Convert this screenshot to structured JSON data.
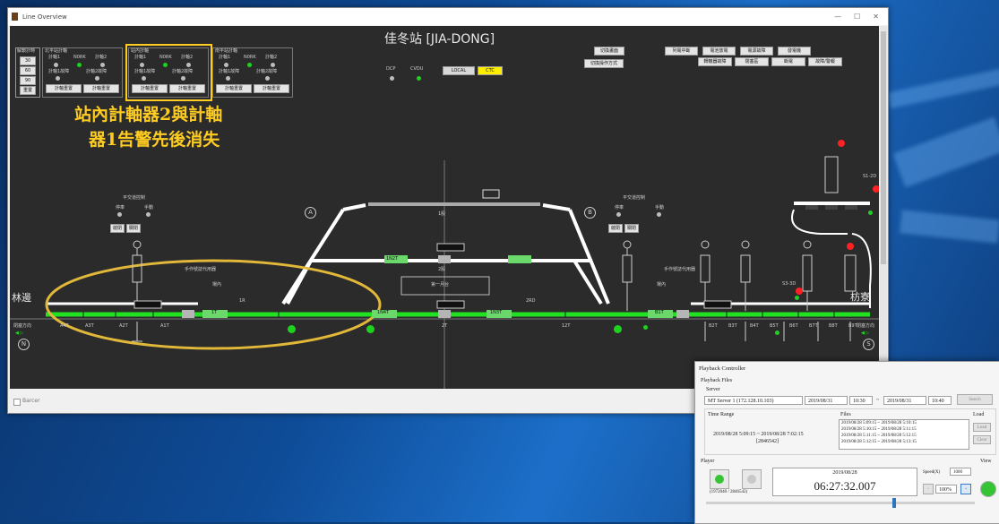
{
  "window": {
    "title": "Line Overview",
    "minimize": "—",
    "maximize": "☐",
    "close": "✕",
    "status_checkbox_label": "Barcer"
  },
  "station_title": "佳冬站 [JIA-DONG]",
  "annotation": {
    "line1": "站內計軸器2與計軸",
    "line2": "器1告警先後消失",
    "highlight_color": "#ffcc22"
  },
  "left_box": {
    "label": "解鎖計時",
    "values": [
      "30",
      "60",
      "90",
      "重置"
    ]
  },
  "axle_groups": [
    {
      "title": "北平站計軸",
      "items": [
        "計軸1",
        "N0RK",
        "計軸2"
      ],
      "sub": [
        "計軸1故障",
        "計軸2故障"
      ],
      "buttons": [
        "計軸重置",
        "計軸重置"
      ]
    },
    {
      "title": "站內計軸",
      "items": [
        "計軸1",
        "N0RK",
        "計軸2"
      ],
      "sub": [
        "計軸1故障",
        "計軸2故障"
      ],
      "buttons": [
        "計軸重置",
        "計軸重置"
      ]
    },
    {
      "title": "南平站計軸",
      "items": [
        "計軸1",
        "N0RK",
        "計軸2"
      ],
      "sub": [
        "計軸1故障",
        "計軸2故障"
      ],
      "buttons": [
        "計軸重置",
        "計軸重置"
      ]
    }
  ],
  "indicators": {
    "dcp": "DCP",
    "cvdu": "CVDU",
    "local": "LOCAL",
    "ctc": "CTC"
  },
  "mid_buttons": [
    "切換畫面",
    "切換操作方式"
  ],
  "right_buttons": [
    "列電中斷",
    "電池放電",
    "電源故障",
    "發電機",
    "轉轍器故障",
    "閉塞區",
    "斷電",
    "故障/警報"
  ],
  "left_station": "林邊",
  "right_station": "枋寮",
  "left_circle": "A",
  "right_circle": "B",
  "left_panel": {
    "title": "平交道控制",
    "opt1": "停車",
    "opt2": "手動",
    "b1": "啟閉",
    "b2": "關閉"
  },
  "right_panel": {
    "title": "平交道控制",
    "opt1": "停車",
    "opt2": "手動",
    "b1": "啟閉",
    "b2": "關閉"
  },
  "direction_left": {
    "label": "閉塞方向",
    "sub": "N"
  },
  "direction_right": {
    "label": "閉塞方向",
    "sub": "S"
  },
  "track_labels": [
    "A4T",
    "A3T",
    "A2T",
    "A1T",
    "1T",
    "2T",
    "1N4T",
    "12T",
    "B1T",
    "B2T",
    "B3T",
    "B4T",
    "B5T",
    "B6T",
    "B7T",
    "B8T",
    "B9T"
  ],
  "upper_labels": [
    "1股",
    "2股",
    "1N2T",
    "2股",
    "第一月台",
    "1N3T",
    "2RD"
  ],
  "signals_left": [
    "出站",
    "手作號誌代用器",
    "場內",
    "1R"
  ],
  "signals_right": [
    "出發",
    "手作號誌代用器",
    "場內",
    "出發",
    "出發",
    "出發",
    "出發"
  ],
  "red_signals": [
    "S1-2D",
    "S3-3D"
  ],
  "playback": {
    "title": "Playback Controller",
    "files_label": "Playback Files",
    "server_label": "Server",
    "server_value": "MT Server 1 (172.128.10.103)",
    "date_from": "2019/08/31",
    "time_from": "10:30",
    "tilde": "~",
    "date_to": "2019/08/31",
    "time_to": "10:40",
    "search": "Search",
    "time_range_label": "Time Range",
    "time_range_value": "2019/08/28 5:09:15 ~ 2019/08/28 7:02:15",
    "time_range_count": "[2846542]",
    "files_col": "Files",
    "load_col": "Load",
    "files": [
      "2019/08/28 5:09:15 ~ 2019/08/28 5:10:15",
      "2019/08/28 5:10:15 ~ 2019/08/28 5:11:15",
      "2019/08/28 5:11:15 ~ 2019/08/28 5:12:15",
      "2019/08/28 5:12:15 ~ 2019/08/28 5:13:15"
    ],
    "load_btn": "Load",
    "clear_btn": "Clear",
    "player_label": "Player",
    "view_label": "View",
    "counter": "(1972040 / 2846542)",
    "date_display": "2019/08/28",
    "time_display": "06:27:32.007",
    "speed_label": "Speed(X)",
    "speed_value": "1000",
    "zoom_value": "100%",
    "position_fraction": 0.7
  },
  "colors": {
    "track_green": "#22e022",
    "track_white": "#ffffff",
    "panel_bg": "#2b2b2b",
    "ellipse": "#e2b83a"
  }
}
